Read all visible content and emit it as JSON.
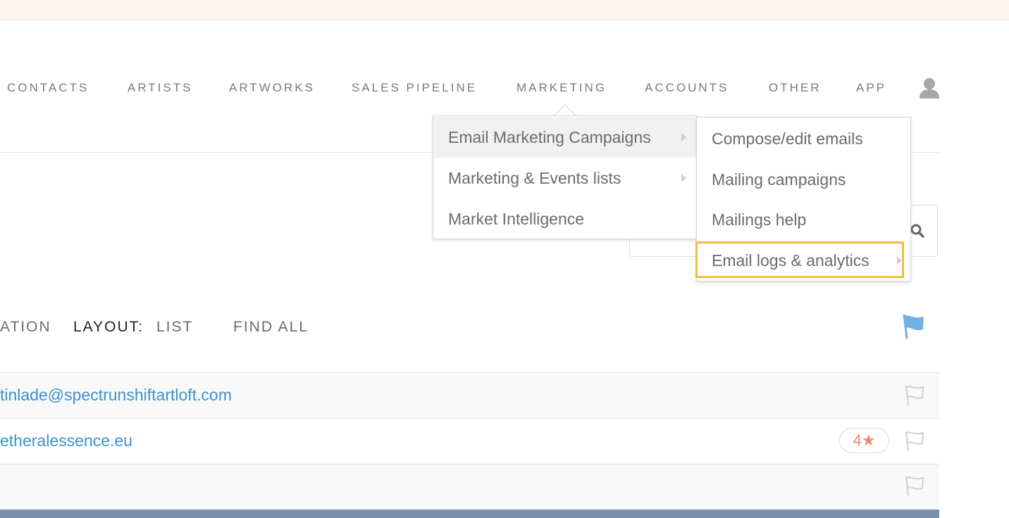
{
  "nav": {
    "items": [
      "CONTACTS",
      "ARTISTS",
      "ARTWORKS",
      "SALES PIPELINE",
      "MARKETING",
      "ACCOUNTS",
      "OTHER",
      "APP"
    ]
  },
  "marketing_menu": {
    "items": [
      {
        "label": "Email Marketing Campaigns",
        "submenu": true,
        "active": true
      },
      {
        "label": "Marketing & Events lists",
        "submenu": true,
        "active": false
      },
      {
        "label": "Market Intelligence",
        "submenu": false,
        "active": false
      }
    ]
  },
  "email_submenu": {
    "items": [
      {
        "label": "Compose/edit emails",
        "submenu": false
      },
      {
        "label": "Mailing campaigns",
        "submenu": false
      },
      {
        "label": "Mailings help",
        "submenu": false
      },
      {
        "label": "Email logs & analytics",
        "submenu": true
      }
    ]
  },
  "toolbar": {
    "partial_label": "ATION",
    "layout_label": "LAYOUT:",
    "layout_value": "LIST",
    "find_all": "FIND ALL"
  },
  "rows": [
    {
      "text": "tinlade@spectrunshiftartloft.com"
    },
    {
      "text": "etheralessence.eu",
      "rating": "4"
    },
    {
      "text": ""
    }
  ],
  "colors": {
    "link": "#3a92cf",
    "highlight": "#f2bd3c",
    "flag": "#6fb1e3",
    "rating": "#e28a6f"
  }
}
